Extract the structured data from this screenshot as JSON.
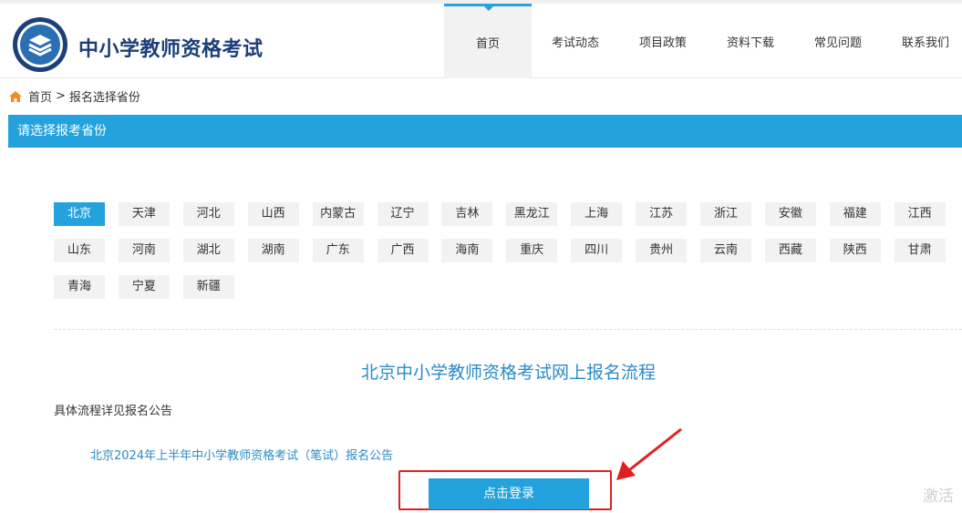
{
  "header": {
    "site_title": "中小学教师资格考试",
    "logo_icon": "certificate-seal-icon",
    "nav": [
      {
        "label": "首页",
        "active": true
      },
      {
        "label": "考试动态",
        "active": false
      },
      {
        "label": "项目政策",
        "active": false
      },
      {
        "label": "资料下载",
        "active": false
      },
      {
        "label": "常见问题",
        "active": false
      },
      {
        "label": "联系我们",
        "active": false
      }
    ]
  },
  "breadcrumb": {
    "icon": "home-icon",
    "home": "首页",
    "separator": ">",
    "current": "报名选择省份"
  },
  "section_title": "请选择报考省份",
  "provinces": [
    "北京",
    "天津",
    "河北",
    "山西",
    "内蒙古",
    "辽宁",
    "吉林",
    "黑龙江",
    "上海",
    "江苏",
    "浙江",
    "安徽",
    "福建",
    "江西",
    "山东",
    "河南",
    "湖北",
    "湖南",
    "广东",
    "广西",
    "海南",
    "重庆",
    "四川",
    "贵州",
    "云南",
    "西藏",
    "陕西",
    "甘肃",
    "青海",
    "宁夏",
    "新疆"
  ],
  "selected_province": "北京",
  "process": {
    "title": "北京中小学教师资格考试网上报名流程",
    "note": "具体流程详见报名公告",
    "notice_link": "北京2024年上半年中小学教师资格考试（笔试）报名公告",
    "login_button": "点击登录"
  },
  "watermark": "激活",
  "colors": {
    "accent": "#24a2dd",
    "title_blue": "#1c3f79",
    "link_blue": "#2a8bc8",
    "highlight_red": "#e02020"
  }
}
